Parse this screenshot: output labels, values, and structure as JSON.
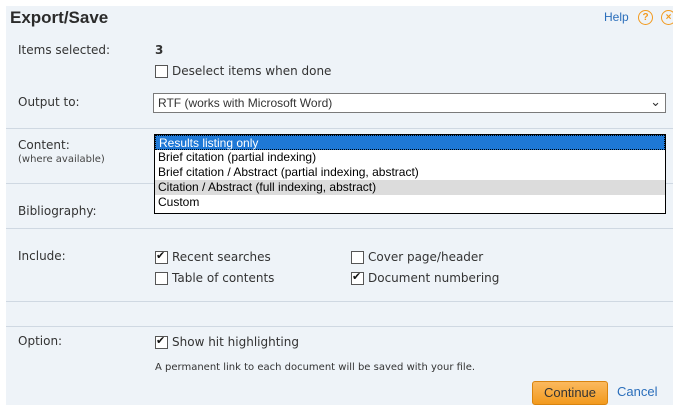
{
  "header": {
    "title": "Export/Save",
    "help_label": "Help"
  },
  "items_selected": {
    "label": "Items selected:",
    "count": "3",
    "deselect_label": "Deselect items when done"
  },
  "output": {
    "label": "Output to:",
    "selected": "RTF (works with Microsoft Word)"
  },
  "content": {
    "label": "Content:",
    "sublabel": "(where available)",
    "options": [
      "Results listing only",
      "Brief citation (partial indexing)",
      "Brief citation / Abstract (partial indexing, abstract)",
      "Citation / Abstract (full indexing, abstract)",
      "Custom"
    ]
  },
  "bibliography": {
    "label": "Bibliography:"
  },
  "include": {
    "label": "Include:",
    "recent_searches": "Recent searches",
    "cover_page": "Cover page/header",
    "table_of_contents": "Table of contents",
    "document_numbering": "Document numbering"
  },
  "option": {
    "label": "Option:",
    "show_hit": "Show hit highlighting",
    "note": "A permanent link to each document will be saved with your file."
  },
  "actions": {
    "continue_label": "Continue",
    "cancel_label": "Cancel"
  }
}
